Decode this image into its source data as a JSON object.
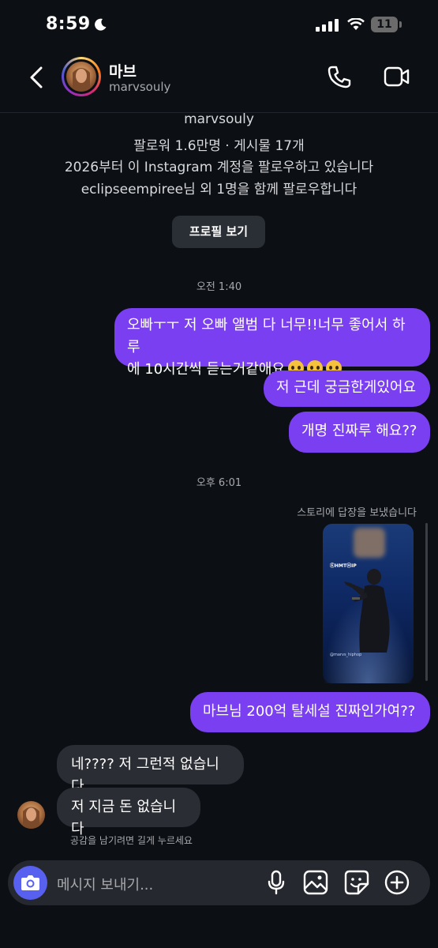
{
  "status_bar": {
    "time": "8:59",
    "battery": "11"
  },
  "header": {
    "name": "마브",
    "username": "marvsouly"
  },
  "profile": {
    "username": "marvsouly",
    "stats": "팔로워 1.6만명 · 게시물 17개",
    "follow_since": "2026부터 이 Instagram 계정을 팔로우하고 있습니다",
    "mutual": "eclipseempiree님 외 1명을 함께 팔로우합니다",
    "view_profile_label": "프로필 보기"
  },
  "timestamps": [
    "오전 1:40",
    "오후 6:01"
  ],
  "messages_out_1": [
    "오빠ㅜㅜ 저 오빠 앨범 다 너무!!너무 좋어서 하루",
    "에 10시간씩 듣는거같애요",
    "저 근데 궁금한게있어요",
    "개명 진짜루 해요??"
  ],
  "story_reply_label": "스토리에 답장을 보냈습니다",
  "story_ribbon": "ⒺHMTⒽIP",
  "story_caption": "@marvs_hiphop",
  "messages_out_2": [
    "마브님 200억 탈세설 진짜인가여??"
  ],
  "messages_in": [
    "네???? 저 그런적 없습니다",
    "저 지금 돈 없습니다"
  ],
  "reaction_hint": "공감을 남기려면 길게 누르세요",
  "composer": {
    "placeholder": "메시지 보내기..."
  },
  "icons": {
    "moon": "moon-icon",
    "signal": "cellular-signal-icon",
    "wifi": "wifi-icon",
    "back": "chevron-left-icon",
    "phone": "phone-icon",
    "video": "video-camera-icon",
    "camera": "camera-icon",
    "mic": "microphone-icon",
    "gallery": "image-icon",
    "sticker": "sticker-icon",
    "plus": "plus-circle-icon"
  },
  "colors": {
    "background": "#0c0f14",
    "outgoing_bubble": "#7b3ff2",
    "incoming_bubble": "#2a2d33",
    "camera_button": "#5860f0"
  }
}
